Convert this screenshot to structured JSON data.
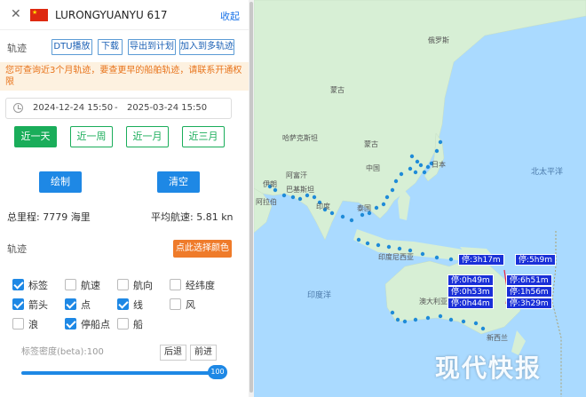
{
  "header": {
    "close": "✕",
    "ship_name": "LURONGYUANYU 617",
    "collapse": "收起",
    "flag_color": "#de2910"
  },
  "track_section": {
    "label": "轨迹",
    "buttons": [
      "DTU播放",
      "下载",
      "导出到计划",
      "加入到多轨迹"
    ]
  },
  "notice": "您可查询近3个月轨迹，要查更早的船舶轨迹，请联系开通权限",
  "date_range": {
    "start": "2024-12-24 15:50",
    "sep": "-",
    "end": "2025-03-24 15:50"
  },
  "quick_ranges": [
    "近一天",
    "近一周",
    "近一月",
    "近三月"
  ],
  "quick_active": 0,
  "actions": {
    "draw": "绘制",
    "clear": "清空"
  },
  "stats": {
    "total_label": "总里程: 7779 海里",
    "avg_label": "平均航速: 5.81 kn"
  },
  "track_options": {
    "label": "轨迹",
    "pick_color": "点此选择颜色",
    "checkboxes": [
      {
        "label": "标签",
        "checked": true
      },
      {
        "label": "航速",
        "checked": false
      },
      {
        "label": "航向",
        "checked": false
      },
      {
        "label": "经纬度",
        "checked": false
      },
      {
        "label": "箭头",
        "checked": true
      },
      {
        "label": "点",
        "checked": true
      },
      {
        "label": "线",
        "checked": true
      },
      {
        "label": "风",
        "checked": false
      },
      {
        "label": "浪",
        "checked": false
      },
      {
        "label": "停船点",
        "checked": true
      },
      {
        "label": "船",
        "checked": false
      }
    ]
  },
  "density": {
    "label": "标签密度(beta):100",
    "back": "后退",
    "forward": "前进",
    "value": "100",
    "fraction": 1.0
  },
  "map": {
    "labels": {
      "mongolia": "蒙古",
      "china": "中国",
      "japan": "日本",
      "kazakh": "哈萨克斯坦",
      "afghan": "阿富汗",
      "pakistan": "巴基斯坦",
      "iran": "伊朗",
      "india": "印度",
      "arabia": "阿拉伯",
      "thailand": "泰国",
      "indonesia": "印度尼西亚",
      "australia": "澳大利亚",
      "indian_ocean": "印度洋",
      "pacific": "北太平洋",
      "newzealand": "新西兰",
      "russia": "俄罗斯"
    },
    "stops": [
      "停:3h17m",
      "停:5h9m",
      "停:0h49m",
      "停:6h51m",
      "停:0h53m",
      "停:1h56m",
      "停:0h44m",
      "停:3h29m"
    ],
    "colors": {
      "water": "#aadaff",
      "land": "#d7efd5",
      "stop_label": "#1a30d8",
      "track_point": "#1f8bd8"
    }
  },
  "watermark": "现代快报"
}
